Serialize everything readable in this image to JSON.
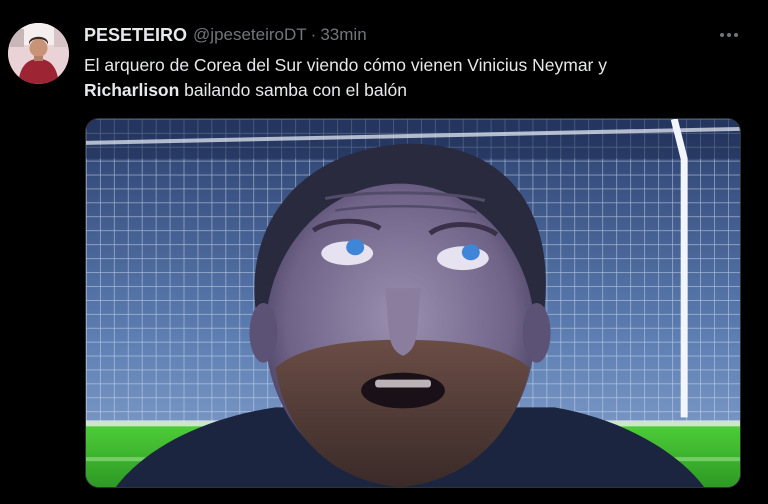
{
  "tweet": {
    "author": {
      "display_name": "PESETEIRO",
      "handle": "@jpeseteiroDT"
    },
    "separator": "·",
    "time_ago": "33min",
    "text_line1": "El arquero de Corea del Sur viendo cómo vienen Vinicius Neymar y",
    "text_bold": "Richarlison",
    "text_line2_rest": " bailando samba con el balón",
    "more_icon": "more-horizontal-icon"
  },
  "colors": {
    "background": "#000000",
    "text": "#e7e9ea",
    "muted": "#71767b",
    "border": "#2f3336"
  }
}
